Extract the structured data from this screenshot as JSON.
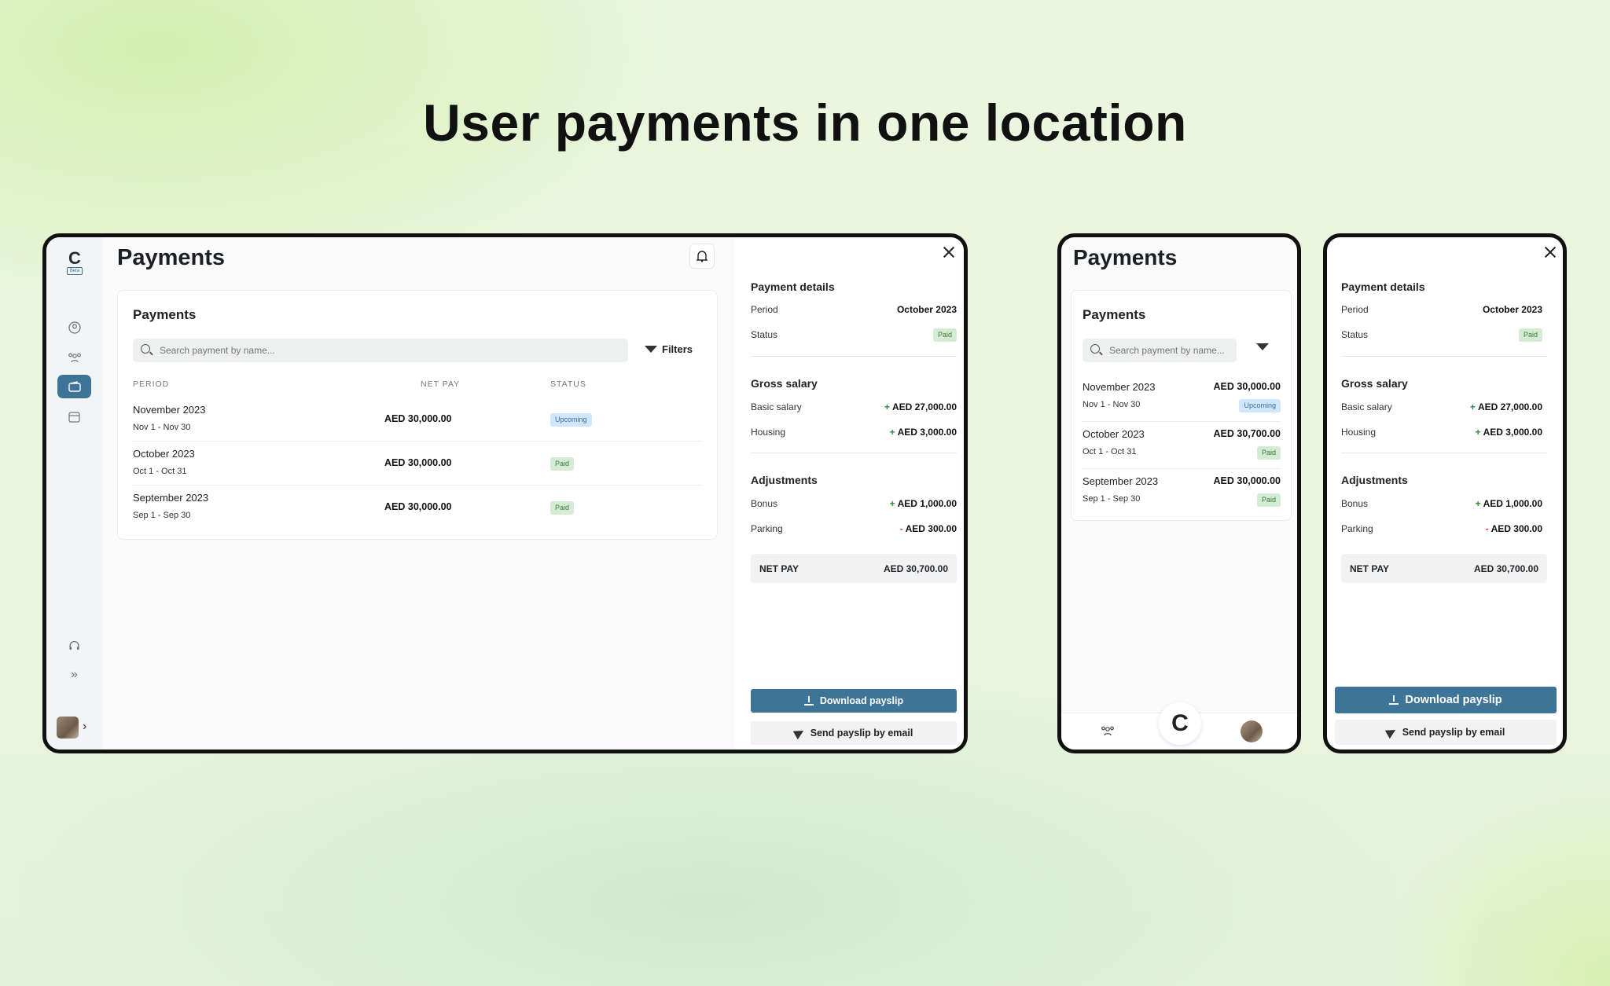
{
  "headline": "User payments in one location",
  "colors": {
    "accent": "#3f7499",
    "paid_bg": "#d4ecd3",
    "upcoming_bg": "#cfe6fb",
    "plus": "#2e8b3a",
    "minus": "#d13b3b"
  },
  "nav": {
    "logo_letter": "C",
    "logo_tag": "Beta",
    "icons": [
      "user-circle-icon",
      "team-icon",
      "wallet-icon",
      "calendar-icon",
      "headset-icon",
      "double-chevron-icon"
    ]
  },
  "page_title": "Payments",
  "list": {
    "title": "Payments",
    "search_placeholder": "Search payment by name...",
    "filters_label": "Filters",
    "columns": {
      "period": "PERIOD",
      "net_pay": "NET PAY",
      "status": "STATUS"
    },
    "rows": [
      {
        "period": "November 2023",
        "range": "Nov 1 - Nov 30",
        "net": "AED 30,000.00",
        "status": "Upcoming"
      },
      {
        "period": "October 2023",
        "range": "Oct 1 - Oct 31",
        "net": "AED 30,000.00",
        "status": "Paid"
      },
      {
        "period": "September 2023",
        "range": "Sep 1 - Sep 30",
        "net": "AED 30,000.00",
        "status": "Paid"
      }
    ],
    "mobile_rows": [
      {
        "period": "November 2023",
        "range": "Nov 1 - Nov 30",
        "net": "AED 30,000.00",
        "status": "Upcoming"
      },
      {
        "period": "October 2023",
        "range": "Oct 1 - Oct 31",
        "net": "AED 30,700.00",
        "status": "Paid"
      },
      {
        "period": "September 2023",
        "range": "Sep 1 - Sep 30",
        "net": "AED 30,000.00",
        "status": "Paid"
      }
    ]
  },
  "details": {
    "title": "Payment details",
    "period_label": "Period",
    "period_value": "October 2023",
    "status_label": "Status",
    "status_value": "Paid",
    "gross_title": "Gross salary",
    "basic_label": "Basic salary",
    "basic_sign": "+",
    "basic_value": "AED 27,000.00",
    "housing_label": "Housing",
    "housing_sign": "+",
    "housing_value": "AED 3,000.00",
    "adj_title": "Adjustments",
    "bonus_label": "Bonus",
    "bonus_sign": "+",
    "bonus_value": "AED 1,000.00",
    "parking_label": "Parking",
    "parking_sign": "-",
    "parking_value": "AED 300.00",
    "net_label": "NET PAY",
    "net_value": "AED 30,700.00",
    "download_label": "Download payslip",
    "email_label": "Send payslip by email"
  }
}
